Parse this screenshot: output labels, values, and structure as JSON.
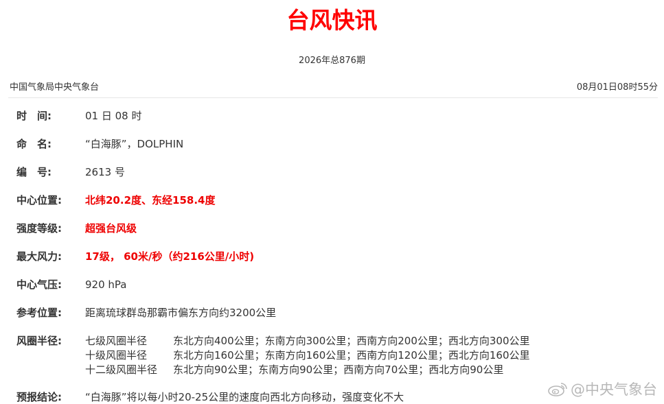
{
  "header": {
    "title": "台风快讯",
    "issue": "2026年总876期",
    "agency": "中国气象局中央气象台",
    "datetime": "08月01日08时55分"
  },
  "fields": {
    "time": {
      "label": "时　间:",
      "value": "01 日 08 时"
    },
    "name": {
      "label": "命　名:",
      "value": "“白海豚”，DOLPHIN"
    },
    "number": {
      "label": "编　号:",
      "value": "2613 号"
    },
    "center": {
      "label": "中心位置:",
      "value": "北纬20.2度、东经158.4度"
    },
    "intensity": {
      "label": "强度等级:",
      "value": "超强台风级"
    },
    "max_wind": {
      "label": "最大风力:",
      "value": "17级， 60米/秒（约216公里/小时)"
    },
    "pressure": {
      "label": "中心气压:",
      "value": "920 hPa"
    },
    "reference": {
      "label": "参考位置:",
      "value": "距离琉球群岛那霸市偏东方向约3200公里"
    },
    "wind_radius": {
      "label": "风圈半径:",
      "lines": [
        {
          "level": "七级风圈半径",
          "detail": "东北方向400公里；东南方向300公里；西南方向200公里；西北方向300公里"
        },
        {
          "level": "十级风圈半径",
          "detail": "东北方向160公里；东南方向160公里；西南方向120公里；西北方向160公里"
        },
        {
          "level": "十二级风圈半径",
          "detail": "东北方向90公里；东南方向90公里；西南方向70公里；西北方向90公里"
        }
      ]
    },
    "forecast": {
      "label": "预报结论:",
      "value": "“白海豚”将以每小时20-25公里的速度向西北方向移动，强度变化不大"
    }
  },
  "watermark": {
    "icon": "weibo-icon",
    "text": "@中央气象台"
  },
  "colors": {
    "title": "#ff0000",
    "highlight": "#ee0000",
    "text": "#333333",
    "watermark": "#b8b8b8"
  }
}
